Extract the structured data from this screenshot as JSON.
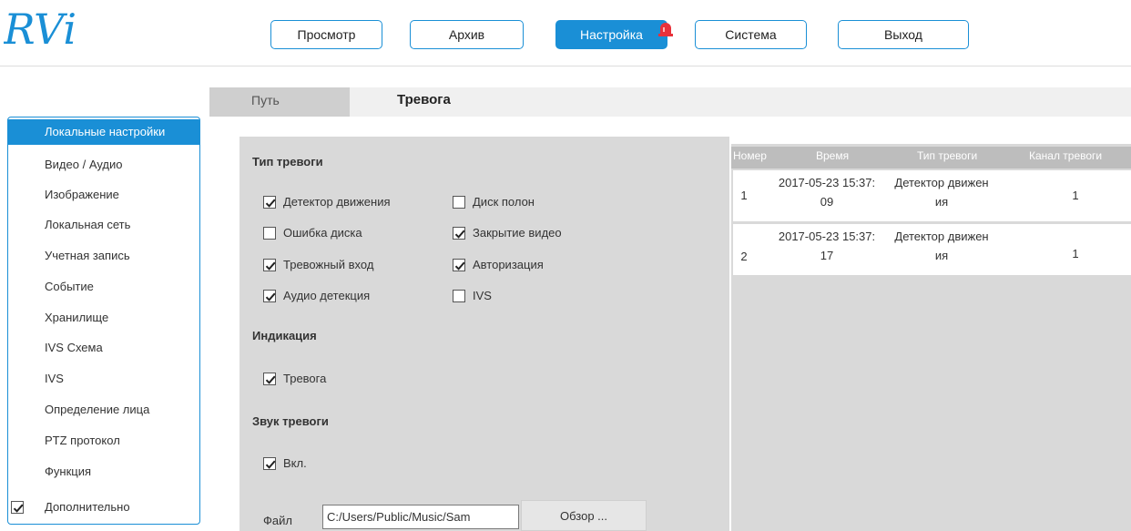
{
  "logo": {
    "text": "RVi"
  },
  "nav": {
    "items": [
      {
        "label": "Просмотр"
      },
      {
        "label": "Архив"
      },
      {
        "label": "Настройка"
      },
      {
        "label": "Система"
      },
      {
        "label": "Выход"
      }
    ],
    "active": "Настройка"
  },
  "tabs": {
    "path": "Путь",
    "alarm": "Тревога"
  },
  "sidebar": {
    "items": [
      {
        "label": "Локальные настройки"
      },
      {
        "label": "Видео / Аудио"
      },
      {
        "label": "Изображение"
      },
      {
        "label": "Локальная сеть"
      },
      {
        "label": "Учетная запись"
      },
      {
        "label": "Событие"
      },
      {
        "label": "Хранилище"
      },
      {
        "label": "IVS Схема"
      },
      {
        "label": "IVS"
      },
      {
        "label": "Определение лица"
      },
      {
        "label": "PTZ протокол"
      },
      {
        "label": "Функция"
      },
      {
        "label": "Дополнительно",
        "checked": true
      }
    ]
  },
  "alarm_type": {
    "title": "Тип тревоги",
    "options": [
      {
        "label": "Детектор движения",
        "checked": true
      },
      {
        "label": "Диск полон",
        "checked": false
      },
      {
        "label": "Ошибка диска",
        "checked": false
      },
      {
        "label": "Закрытие видео",
        "checked": true
      },
      {
        "label": "Тревожный вход",
        "checked": true
      },
      {
        "label": "Авторизация",
        "checked": true
      },
      {
        "label": "Аудио детекция",
        "checked": true
      },
      {
        "label": "IVS",
        "checked": false
      }
    ]
  },
  "indication": {
    "title": "Индикация",
    "alarm_label": "Тревога",
    "alarm_checked": true
  },
  "sound": {
    "title": "Звук тревоги",
    "on_label": "Вкл.",
    "on_checked": true,
    "file_label": "Файл",
    "file_value": "C:/Users/Public/Music/Sam",
    "browse_label": "Обзор ..."
  },
  "events": {
    "columns": [
      "Номер",
      "Время",
      "Тип тревоги",
      "Канал тревоги"
    ],
    "rows": [
      {
        "num": "1",
        "time_1": "2017-05-23 15:37:",
        "time_2": "09",
        "type_1": "Детектор движен",
        "type_2": "ия",
        "channel": "1"
      },
      {
        "num": "2",
        "time_1": "2017-05-23 15:37:",
        "time_2": "17",
        "type_1": "Детектор движен",
        "type_2": "ия",
        "channel": "1"
      }
    ]
  },
  "colors": {
    "accent": "#1a8fd6",
    "panel": "#d9d9d9",
    "alarm_icon": "#e8313a"
  }
}
